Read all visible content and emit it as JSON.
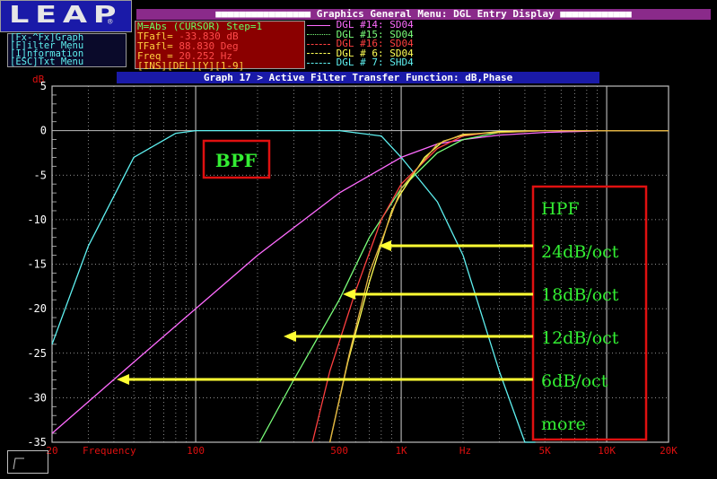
{
  "logo": {
    "text": "LEAP",
    "mark": "®"
  },
  "menu_title": "■■■■■■■■■■■■■■■■ Graphics General Menu: DGL Entry Display ■■■■■■■■■■■■",
  "help_menu": [
    "[Fx-^Fx]Graph",
    "[F]ilter Menu",
    "[I]nformation",
    "[ESC]Txt Menu"
  ],
  "cursor_readout": {
    "top": "M=Abs (CURSOR) Step=1",
    "lines": [
      {
        "label": "TFafl=",
        "value": "-33.830 dB"
      },
      {
        "label": "TFafl=",
        "value": "88.830 Deg"
      },
      {
        "label": "Freq =",
        "value": "20.252 Hz"
      }
    ],
    "bottom": "[INS][DEL][Y][1-9]"
  },
  "dgl_legend": [
    {
      "text": "DGL #14: SD04",
      "color": "#ff6bff"
    },
    {
      "text": "DGL #15: SD04",
      "color": "#7aff7a"
    },
    {
      "text": "DGL #16: SD04",
      "color": "#ff4040"
    },
    {
      "text": "DGL # 6: SD04",
      "color": "#ffff55"
    },
    {
      "text": "DGL # 7: SHD4",
      "color": "#5ef0f0"
    }
  ],
  "graph_title": "Graph 17 > Active Filter Transfer Function: dB,Phase",
  "chart_data": {
    "type": "line",
    "xscale": "log",
    "xlim": [
      20,
      20000
    ],
    "ylim": [
      -35,
      5
    ],
    "ylabel": "dB",
    "xlabel": "Frequency",
    "x_ticks": [
      "20",
      "Frequency",
      "100",
      "500",
      "1K",
      "Hz",
      "5K",
      "10K",
      "20K"
    ],
    "y_ticks": [
      "5",
      "0",
      "-5",
      "-10",
      "-15",
      "-20",
      "-25",
      "-30",
      "-35"
    ],
    "grid": true,
    "series": [
      {
        "color": "#5ef0f0",
        "x": [
          20,
          30,
          50,
          80,
          100,
          200,
          500,
          800,
          1000,
          1500,
          2000,
          3000,
          4000,
          4500
        ],
        "y": [
          -24,
          -13,
          -3,
          -0.3,
          0,
          0,
          0,
          -0.6,
          -3,
          -8,
          -14,
          -27,
          -35,
          -35
        ]
      },
      {
        "color": "#ff6bff",
        "x": [
          20,
          50,
          100,
          200,
          500,
          1000,
          1500,
          2000,
          3000,
          5000,
          10000,
          20000
        ],
        "y": [
          -34,
          -26,
          -20,
          -14,
          -7,
          -3,
          -1.5,
          -1,
          -0.5,
          -0.2,
          0,
          0
        ]
      },
      {
        "color": "#7aff7a",
        "x": [
          205,
          300,
          500,
          700,
          1000,
          1500,
          2000,
          3000,
          5000,
          10000,
          20000
        ],
        "y": [
          -35,
          -28,
          -19,
          -12,
          -6.5,
          -2.5,
          -1,
          -0.2,
          0,
          0,
          0
        ]
      },
      {
        "color": "#ff4040",
        "x": [
          370,
          450,
          600,
          800,
          1000,
          1500,
          2000,
          3000,
          5000,
          10000,
          20000
        ],
        "y": [
          -35,
          -27,
          -18,
          -10,
          -6,
          -2,
          -0.6,
          -0.1,
          0,
          0,
          0
        ]
      },
      {
        "color": "#ffff55",
        "x": [
          450,
          550,
          700,
          900,
          1000,
          1300,
          1600,
          2000,
          3000,
          5000,
          10000,
          20000
        ],
        "y": [
          -35,
          -26,
          -17,
          -9,
          -7,
          -3,
          -1.2,
          -0.5,
          -0.1,
          0,
          0,
          0
        ]
      },
      {
        "color": "#e0b040",
        "x": [
          450,
          560,
          700,
          1000,
          1500,
          2000,
          5000,
          20000
        ],
        "y": [
          -35,
          -25,
          -16,
          -6.5,
          -1.5,
          -0.4,
          0,
          0
        ]
      }
    ]
  },
  "annotations": {
    "bpf": "BPF",
    "hpf_box": [
      "HPF",
      "24dB/oct",
      "18dB/oct",
      "12dB/oct",
      "6dB/oct",
      "more"
    ]
  },
  "colors": {
    "accent_red": "#e01010",
    "annotation_text": "#33ee33",
    "arrow": "#ffff33",
    "grid": "#bfbfbf"
  }
}
